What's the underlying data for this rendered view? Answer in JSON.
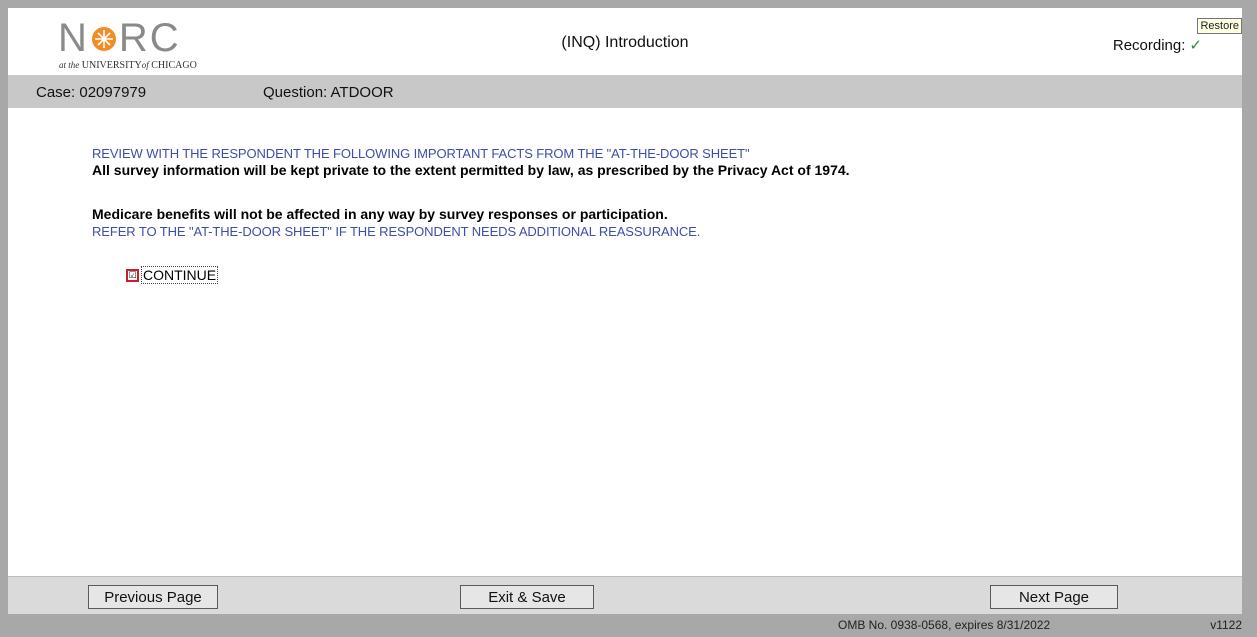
{
  "header": {
    "logo": {
      "word_left": "N",
      "word_right": "RC",
      "subtitle_pre": "at the",
      "subtitle_univ": "UNIVERSITY",
      "subtitle_of": "of",
      "subtitle_city": "CHICAGO"
    },
    "title": "(INQ) Introduction",
    "recording_label": "Recording:",
    "recording_check": "✓",
    "tooltip": "Restore"
  },
  "infobar": {
    "case": "Case: 02097979",
    "question": "Question: ATDOOR"
  },
  "content": {
    "instruction_1": "REVIEW WITH THE RESPONDENT THE FOLLOWING IMPORTANT FACTS FROM THE \"AT-THE-DOOR SHEET\"",
    "statement_1": "All survey information will be kept private to the extent permitted by law, as prescribed by the Privacy Act of 1974.",
    "statement_2": "Medicare benefits will not be affected in any way by survey responses or participation.",
    "instruction_2": "REFER TO THE \"AT-THE-DOOR SHEET\" IF THE RESPONDENT NEEDS ADDITIONAL REASSURANCE.",
    "answer": {
      "label": "CONTINUE",
      "checked": true,
      "check_glyph": "☑"
    }
  },
  "footer": {
    "prev_label": "Previous Page",
    "exit_label": "Exit & Save",
    "next_label": "Next Page"
  },
  "status": {
    "omb": "OMB No. 0938-0568, expires 8/31/2022",
    "version": "v1122"
  },
  "colors": {
    "instruction_blue": "#3b4fa8",
    "infobar_gray": "#c8c8c8",
    "checkbox_red": "#c8202a",
    "logo_orange": "#f28c28",
    "recording_green": "#2e8b2e"
  }
}
